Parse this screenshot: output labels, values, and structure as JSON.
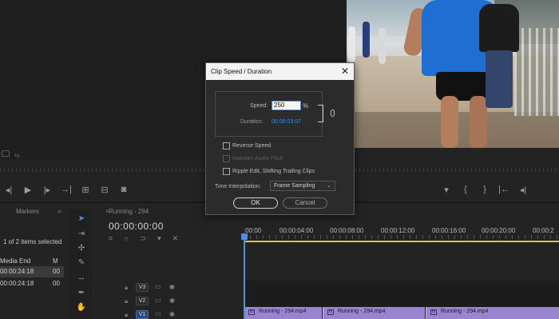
{
  "dialog": {
    "title": "Clip Speed / Duration",
    "speed_label": "Speed:",
    "speed_value": "250",
    "percent": "%",
    "duration_label": "Duration:",
    "duration_value": "00:00:03:07",
    "reverse_speed": "Reverse Speed",
    "maintain_pitch": "Maintain Audio Pitch",
    "ripple_edit": "Ripple Edit, Shifting Trailing Clips",
    "interpolation_label": "Time Interpolation:",
    "interpolation_value": "Frame Sampling",
    "ok": "OK",
    "cancel": "Cancel"
  },
  "project": {
    "tab": "Markers",
    "items_selected": "1 of 2 items selected",
    "col_media_end": "Media End",
    "col_m": "M",
    "rows": [
      {
        "media_end": "00:00:24:18",
        "m": "00"
      },
      {
        "media_end": "00:00:24:18",
        "m": "00"
      }
    ]
  },
  "sequence": {
    "tab": "Running - 294",
    "timecode": "00:00:00:00",
    "ruler": [
      ":00:00",
      "00:00:04:00",
      "00:00:08:00",
      "00:00:12:00",
      "00:00:16:00",
      "00:00:20:00",
      "00:00:2"
    ],
    "tracks": [
      "V3",
      "V2",
      "V1"
    ],
    "clips": [
      "Running - 294.mp4",
      "Running - 294.mp4",
      "Running - 294.mp4"
    ]
  },
  "colors": {
    "accent": "#3d8fe6",
    "clip": "#9a83d0",
    "work_area": "#d8c64a",
    "runner_shirt": "#1f6fd2"
  }
}
